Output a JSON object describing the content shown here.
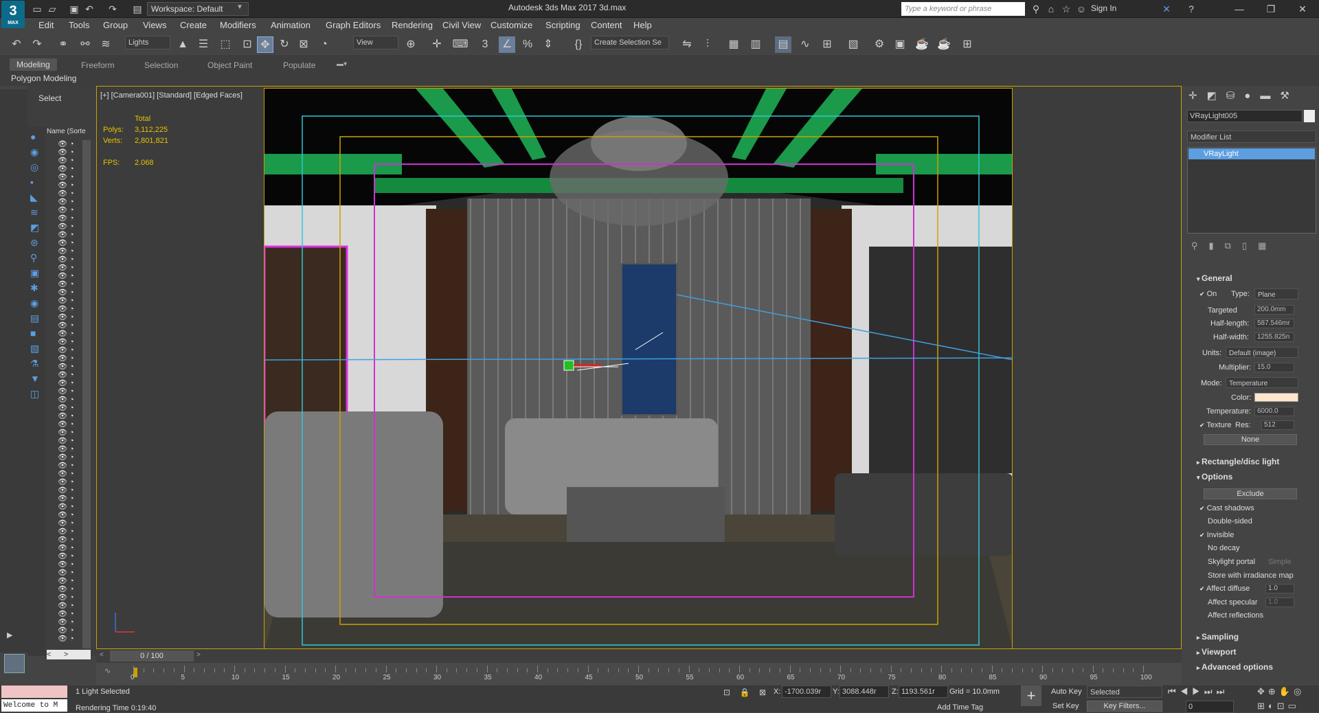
{
  "titlebar": {
    "workspace": "Workspace: Default",
    "title": "Autodesk 3ds Max 2017    3d.max",
    "search_placeholder": "Type a keyword or phrase",
    "sign_in": "Sign In",
    "logo": "3",
    "logo_sub": "MAX"
  },
  "menu": [
    "Edit",
    "Tools",
    "Group",
    "Views",
    "Create",
    "Modifiers",
    "Animation",
    "Graph Editors",
    "Rendering",
    "Civil View",
    "Customize",
    "Scripting",
    "Content",
    "Help"
  ],
  "toolbar": {
    "filter": "Lights",
    "ref_coord": "View",
    "selection_set": "Create Selection Se"
  },
  "ribbon": {
    "tabs": [
      "Modeling",
      "Freeform",
      "Selection",
      "Object Paint",
      "Populate"
    ],
    "sub": "Polygon Modeling"
  },
  "scene": {
    "select": "Select",
    "column": "Name (Sorte",
    "page": "0 / 100"
  },
  "viewport": {
    "label": "[+] [Camera001] [Standard] [Edged Faces]",
    "total": "Total",
    "polys_label": "Polys:",
    "polys": "3,112,225",
    "verts_label": "Verts:",
    "verts": "2,801,821",
    "fps_label": "FPS:",
    "fps": "2.068"
  },
  "panel": {
    "object_name": "VRayLight005",
    "modifier_list": "Modifier List",
    "stack_item": "VRayLight",
    "general": "General",
    "on": "On",
    "type_label": "Type:",
    "type": "Plane",
    "targeted": "Targeted",
    "targeted_val": "200.0mm",
    "half_length_label": "Half-length:",
    "half_length": "587.546mr",
    "half_width_label": "Half-width:",
    "half_width": "1255.825n",
    "units_label": "Units:",
    "units": "Default (image)",
    "multiplier_label": "Multiplier:",
    "multiplier": "15.0",
    "mode_label": "Mode:",
    "mode": "Temperature",
    "color_label": "Color:",
    "temperature_label": "Temperature:",
    "temperature": "6000.0",
    "texture": "Texture",
    "res_label": "Res:",
    "res": "512",
    "none": "None",
    "rect": "Rectangle/disc light",
    "options": "Options",
    "exclude": "Exclude",
    "opts": [
      "Cast shadows",
      "Double-sided",
      "Invisible",
      "No decay",
      "Skylight portal",
      "Store with irradiance map",
      "Affect diffuse",
      "Affect specular",
      "Affect reflections"
    ],
    "simple": "Simple",
    "affect_diffuse_val": "1.0",
    "affect_specular_val": "1.0",
    "sampling": "Sampling",
    "viewport": "Viewport",
    "advanced": "Advanced options"
  },
  "timeline": {
    "ticks": [
      "0",
      "5",
      "10",
      "15",
      "20",
      "25",
      "30",
      "35",
      "40",
      "45",
      "50",
      "55",
      "60",
      "65",
      "70",
      "75",
      "80",
      "85",
      "90",
      "95",
      "100"
    ]
  },
  "status": {
    "welcome": "Welcome to M",
    "selected": "1 Light Selected",
    "render_time": "Rendering Time  0:19:40",
    "x_label": "X:",
    "x": "-1700.039r",
    "y_label": "Y:",
    "y": "3088.448r",
    "z_label": "Z:",
    "z": "1193.561r",
    "grid": "Grid = 10.0mm",
    "add_time_tag": "Add Time Tag",
    "auto_key": "Auto Key",
    "set_key": "Set Key",
    "selected_dd": "Selected",
    "key_filters": "Key Filters...",
    "frame": "0"
  },
  "colors": {
    "accent": "#5c9ee0",
    "viewport_border": "#c9a200",
    "stats": "#e8c200"
  }
}
